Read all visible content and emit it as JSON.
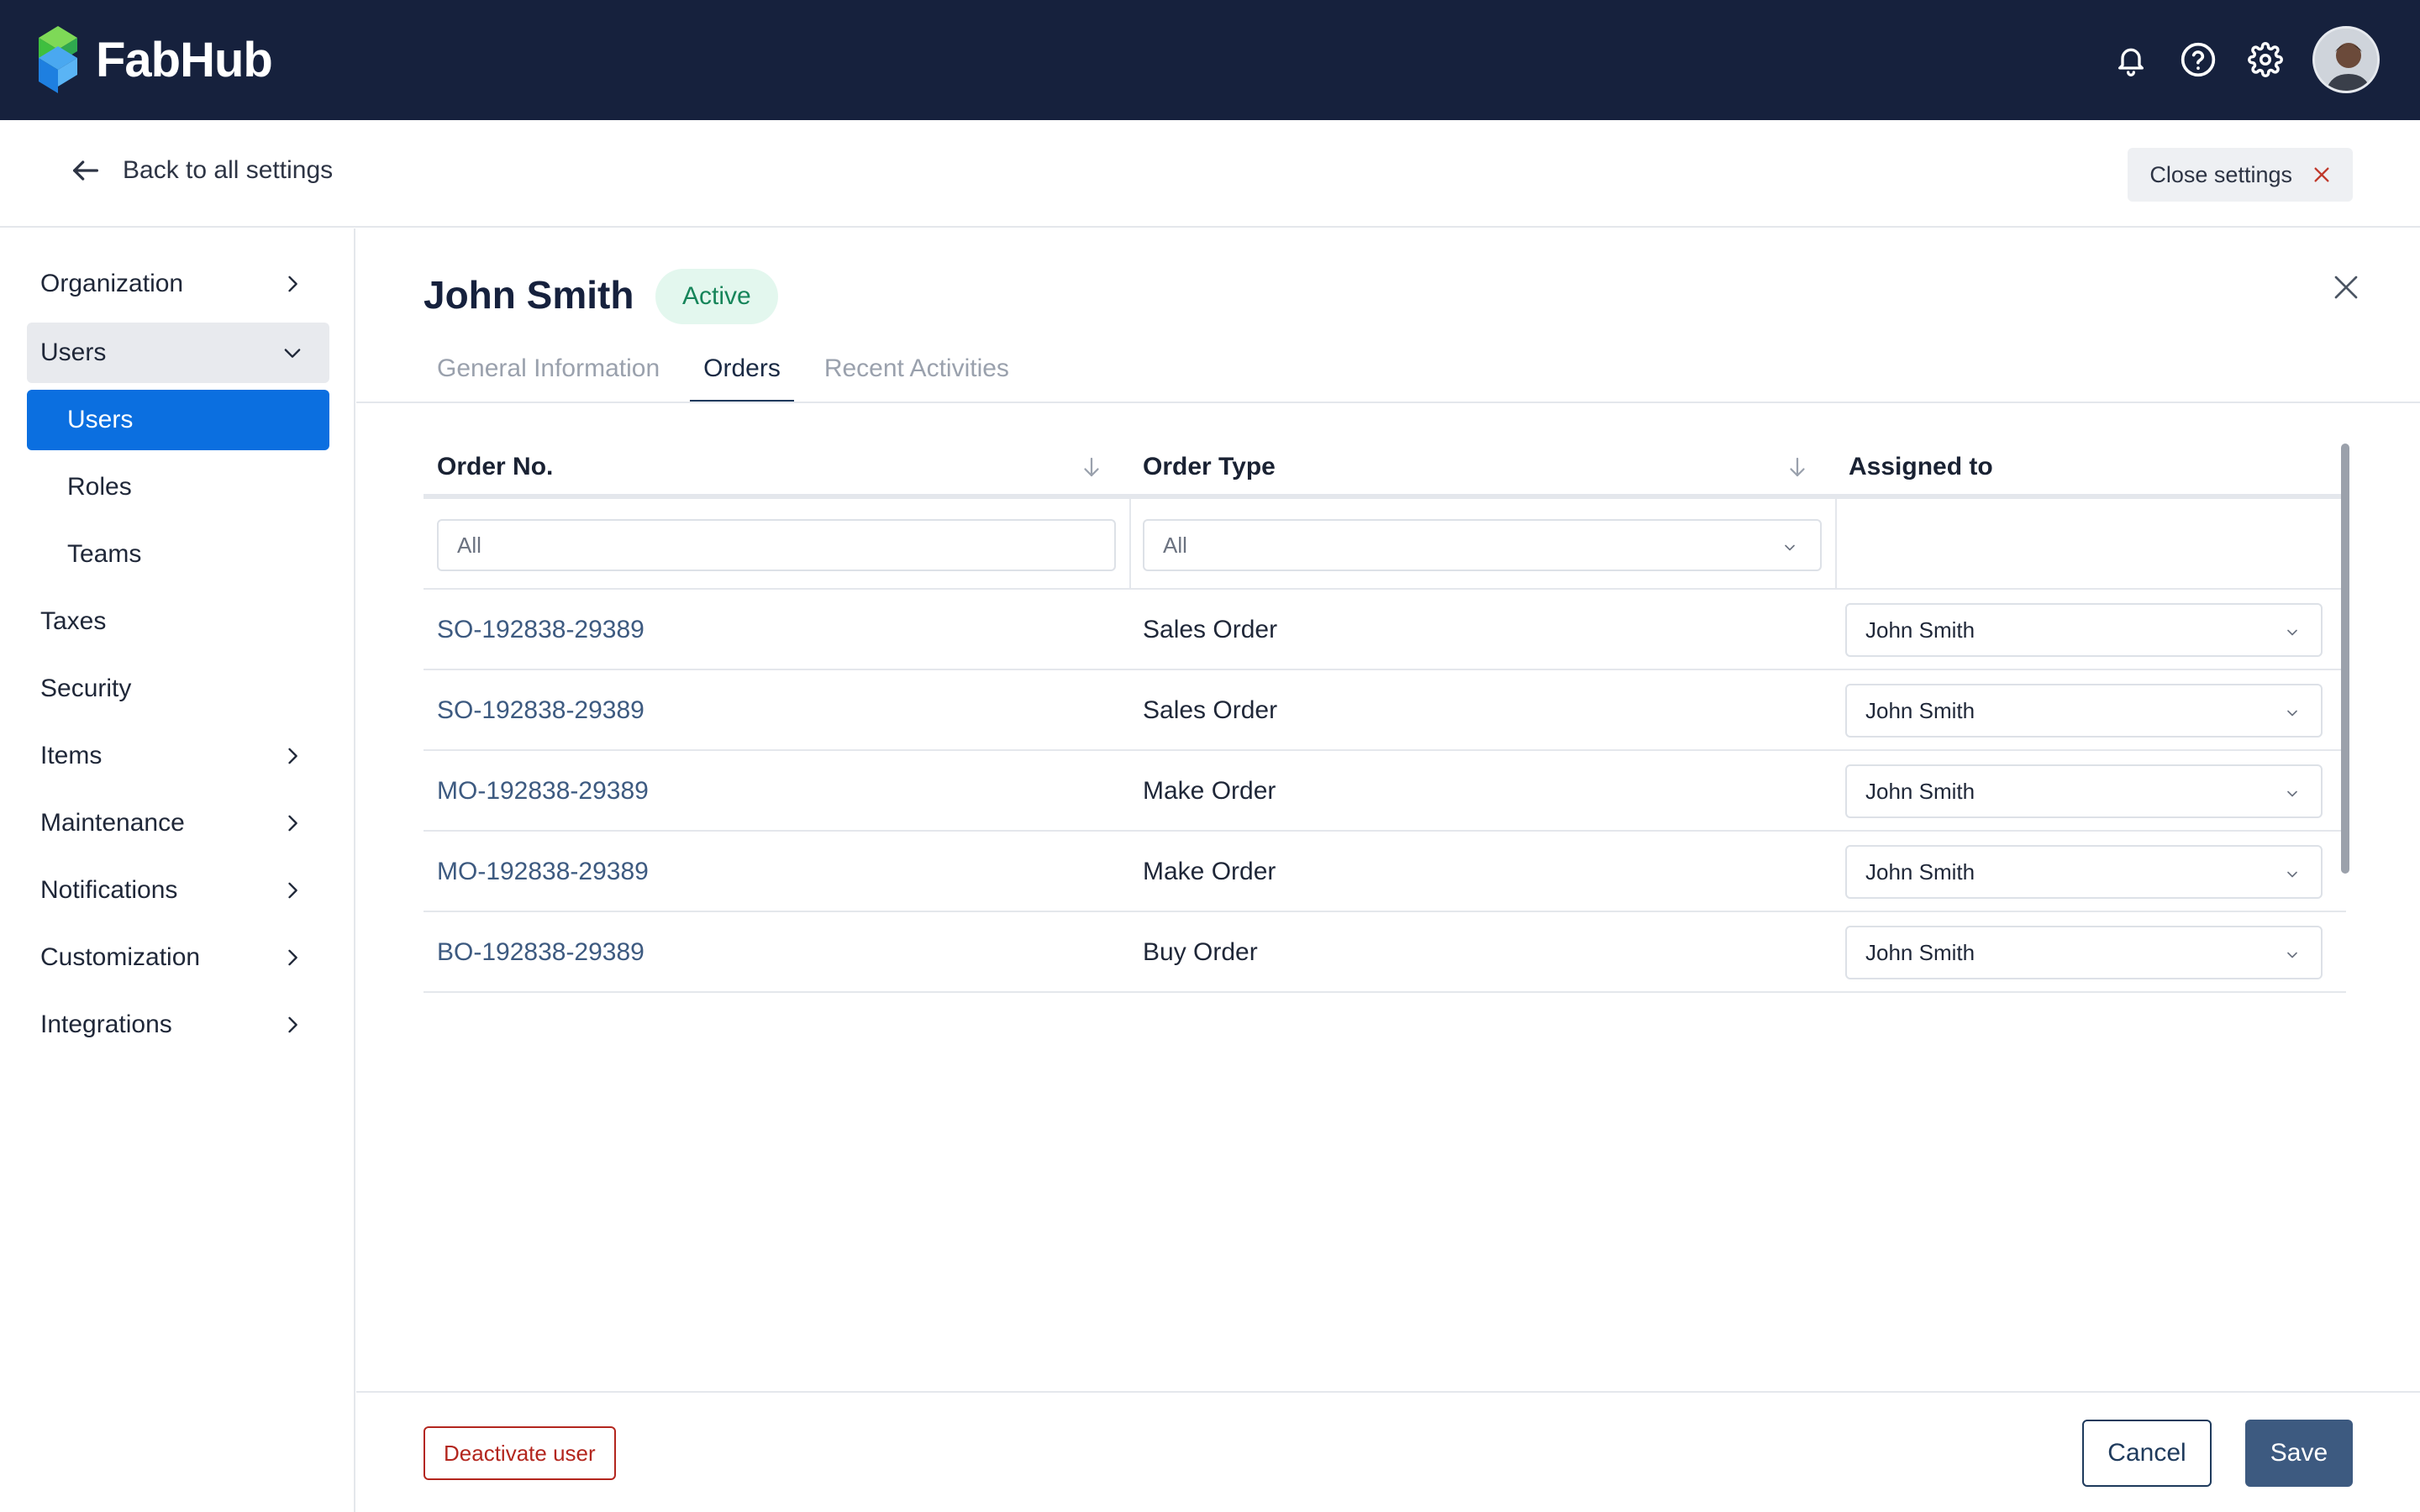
{
  "app": {
    "name": "FabHub"
  },
  "topbar": {
    "icons": [
      "bell-icon",
      "help-circle-icon",
      "gear-icon"
    ],
    "avatar": "user-avatar"
  },
  "subbar": {
    "back_label": "Back to all settings",
    "close_label": "Close settings"
  },
  "sidebar": {
    "items": [
      {
        "label": "Organization",
        "icon": "chevron-right-icon"
      },
      {
        "label": "Users",
        "icon": "chevron-down-icon"
      },
      {
        "label": "Users"
      },
      {
        "label": "Roles"
      },
      {
        "label": "Teams"
      },
      {
        "label": "Taxes"
      },
      {
        "label": "Security"
      },
      {
        "label": "Items",
        "icon": "chevron-right-icon"
      },
      {
        "label": "Maintenance",
        "icon": "chevron-right-icon"
      },
      {
        "label": "Notifications",
        "icon": "chevron-right-icon"
      },
      {
        "label": "Customization",
        "icon": "chevron-right-icon"
      },
      {
        "label": "Integrations",
        "icon": "chevron-right-icon"
      }
    ]
  },
  "user": {
    "name": "John Smith",
    "status": "Active"
  },
  "tabs": [
    "General Information",
    "Orders",
    "Recent Activities"
  ],
  "active_tab": "Orders",
  "table": {
    "columns": [
      "Order No.",
      "Order Type",
      "Assigned to"
    ],
    "filters": {
      "order_no": "All",
      "order_type": "All"
    },
    "rows": [
      {
        "order_no": "SO-192838-29389",
        "type": "Sales Order",
        "assigned": "John Smith"
      },
      {
        "order_no": "SO-192838-29389",
        "type": "Sales Order",
        "assigned": "John Smith"
      },
      {
        "order_no": "MO-192838-29389",
        "type": "Make Order",
        "assigned": "John Smith"
      },
      {
        "order_no": "MO-192838-29389",
        "type": "Make Order",
        "assigned": "John Smith"
      },
      {
        "order_no": "BO-192838-29389",
        "type": "Buy Order",
        "assigned": "John Smith"
      }
    ]
  },
  "footer": {
    "deactivate_label": "Deactivate user",
    "cancel_label": "Cancel",
    "save_label": "Save"
  },
  "colors": {
    "navbar": "#16213d",
    "primary": "#0b6fe0",
    "save": "#3d5a80",
    "danger": "#b3261e",
    "active_badge_bg": "#e3f7ee",
    "active_badge_text": "#16855a"
  }
}
